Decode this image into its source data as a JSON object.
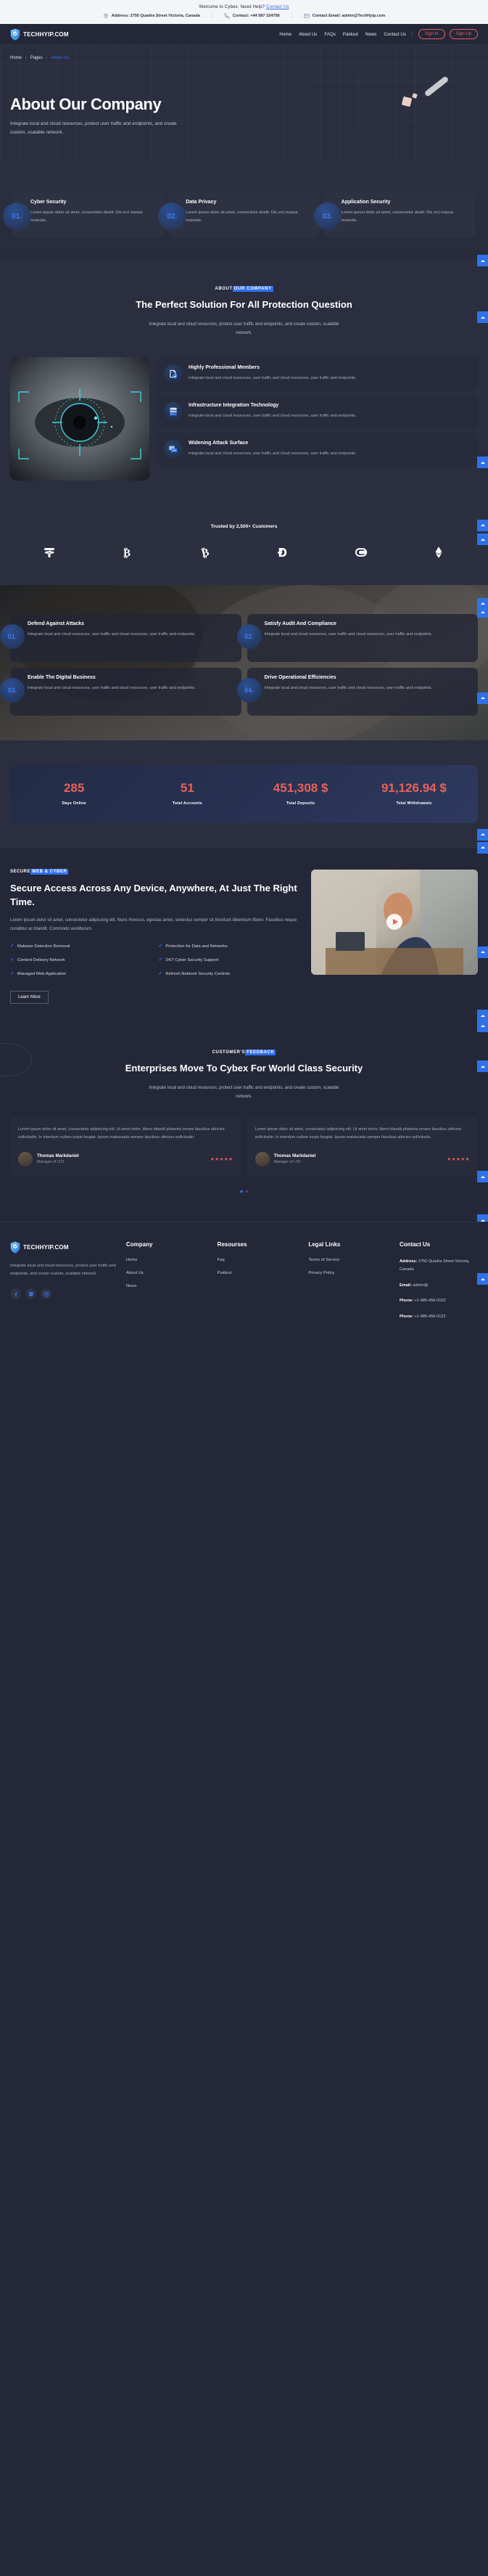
{
  "topbar": {
    "welcome_prefix": "Welcome to Cybex. Need Help? ",
    "welcome_link": "Contact Us",
    "address": "Address: 2750 Quadra Street Victoria, Canada",
    "phone": "Contact: +44 587 154756",
    "email": "Contact Email: admin@TechHyip.com"
  },
  "nav": {
    "brand": "TECHHYIP.COM",
    "links": [
      "Home",
      "About Us",
      "FAQs",
      "Paidout",
      "News",
      "Contact Us"
    ],
    "sign_in": "Sign In",
    "sign_up": "Sign Up"
  },
  "hero": {
    "breadcrumb": [
      "Home",
      "Pages",
      "About Us"
    ],
    "title": "About Our Company",
    "subtitle": "Integrate local and cloud resources, protect user traffic and endpoints, and create custom, scalable network."
  },
  "services": [
    {
      "num": "01.",
      "title": "Cyber Security",
      "desc": "Lorem ipsum dolor sit amet, consectetur deelit. Dis orci massa molestie."
    },
    {
      "num": "02.",
      "title": "Data Privacy",
      "desc": "Lorem ipsum dolor sit amet, consectetur deelit. Dis orci massa molestie."
    },
    {
      "num": "03.",
      "title": "Application Security",
      "desc": "Lorem ipsum dolor sit amet, consectetur deelit. Dis orci massa molestie."
    }
  ],
  "about": {
    "eyebrow_plain": "ABOUT",
    "eyebrow_highlight": "OUR COMPANY",
    "heading": "The Perfect Solution For All Protection Question",
    "paragraph": "Integrate local and cloud resources, protect user traffic and endpoints, and create custom, scalable network."
  },
  "features": [
    {
      "icon": "document-shield-icon",
      "title": "Highly Professional Members",
      "desc": "Integrate local and cloud resources, user traffic and cloud resources, user traffic and endpoints."
    },
    {
      "icon": "server-rack-icon",
      "title": "Infrastructure Integration Technology",
      "desc": "Integrate local and cloud resources, user traffic and cloud resources, user traffic and endpoints."
    },
    {
      "icon": "chat-shield-icon",
      "title": "Widening Attack Surface",
      "desc": "Integrate local and cloud resources, user traffic and cloud resources, user traffic and endpoints."
    }
  ],
  "trusted": {
    "title": "Trusted by 2,500+ Customers",
    "logos": [
      "tether-icon",
      "bitcoin-icon",
      "bitcoin-cash-icon",
      "dogecoin-icon",
      "wallet-icon",
      "ethereum-icon"
    ]
  },
  "benefits": [
    {
      "num": "01.",
      "title": "Defend Against Attacks",
      "desc": "Integrate local and cloud resources, user traffic and cloud resources, user traffic and endpoints."
    },
    {
      "num": "02.",
      "title": "Satisfy Audit And Compliance",
      "desc": "Integrate local and cloud resources, user traffic and cloud resources, user traffic and endpoints."
    },
    {
      "num": "03.",
      "title": "Enable The Digital Business",
      "desc": "Integrate local and cloud resources, user traffic and cloud resources, user traffic and endpoints."
    },
    {
      "num": "04.",
      "title": "Drive Operational Efficiencies",
      "desc": "Integrate local and cloud resources, user traffic and cloud resources, user traffic and endpoints."
    }
  ],
  "stats": [
    {
      "value": "285",
      "label": "Days Online"
    },
    {
      "value": "51",
      "label": "Total Accounts"
    },
    {
      "value": "451,308 $",
      "label": "Total Deposits"
    },
    {
      "value": "91,126.94 $",
      "label": "Total Withdrawals"
    }
  ],
  "secure": {
    "eyebrow_plain": "SECURE",
    "eyebrow_highlight": "WEB & CYBER",
    "heading": "Secure Access Across Any Device, Anywhere, At Just The Right Time.",
    "paragraph": "Lorem ipsum dolor sit amet, consectetur adipiscing elit. Nunc rhoncus, egestas amet, senectus semper sit tincidunt bibendum libero. Faucibus neque curabitur ac blandit. Commodo vestibulum.",
    "checks": [
      "Malware Detection Removal",
      "Protection for Data and Networks",
      "Content Delivery Network",
      "24/7 Cyber Security Support",
      "Managed Web Application",
      "Refresh Network Security Controls"
    ],
    "cta": "Learn More"
  },
  "testimonials": {
    "eyebrow_plain": "CUSTOMER'S",
    "eyebrow_highlight": "FEEDBACK",
    "heading": "Enterprises Move To Cybex For World Class Security",
    "paragraph": "Integrate local and cloud resources, protect user traffic and endpoints, and create custom, scalable network.",
    "items": [
      {
        "text": "Lorem ipsum dolor sit amet, consectetur adipiscing elit. Ut amet tortor, libero blandit pharetra ornare faucibus ultricies sollicitudin. In interdum nullam turpis feugiat. Ipsum malesuada semper faucibus ultricies sollicitudin.",
        "name": "Thomas Markdaniel",
        "role": "Manager of LTD",
        "rating": "★★★★★"
      },
      {
        "text": "Lorem ipsum dolor sit amet, consectetur adipiscing elit. Ut amet tortor, libero blandit pharetra ornare faucibus ultricies sollicitudin. In interdum nullam turpis feugiat. Ipsum malesuada semper faucibus ultricies sollicitudin.",
        "name": "Thomas Markdaniel",
        "role": "Manager of LTD",
        "rating": "★★★★★"
      }
    ]
  },
  "footer": {
    "brand": "TECHHYIP.COM",
    "about": "Integrate local and cloud resources, protect user traffic and endpoints, and create custom, scalable network.",
    "social": [
      "facebook-icon",
      "twitch-icon",
      "instagram-icon"
    ],
    "company": {
      "heading": "Company",
      "links": [
        "Home",
        "About Us",
        "News"
      ]
    },
    "resources": {
      "heading": "Resourses",
      "links": [
        "Faq",
        "Paidout"
      ]
    },
    "legal": {
      "heading": "Legal Links",
      "links": [
        "Terms of Service",
        "Privacy Policy"
      ]
    },
    "contact": {
      "heading": "Contact Us",
      "address_label": "Address:",
      "address_value": "2750 Quadra Street Victoria, Canada",
      "email_label": "Email:",
      "email_value": "admin@",
      "phone1_label": "Phone:",
      "phone1_value": "+1-485-456-0102",
      "phone2_label": "Phone:",
      "phone2_value": "+1-485-456-0122"
    }
  },
  "colors": {
    "accent_blue": "#2f6ef0",
    "accent_red": "#e8625a",
    "bg_dark": "#232738",
    "bg_panel": "#272b3b"
  }
}
